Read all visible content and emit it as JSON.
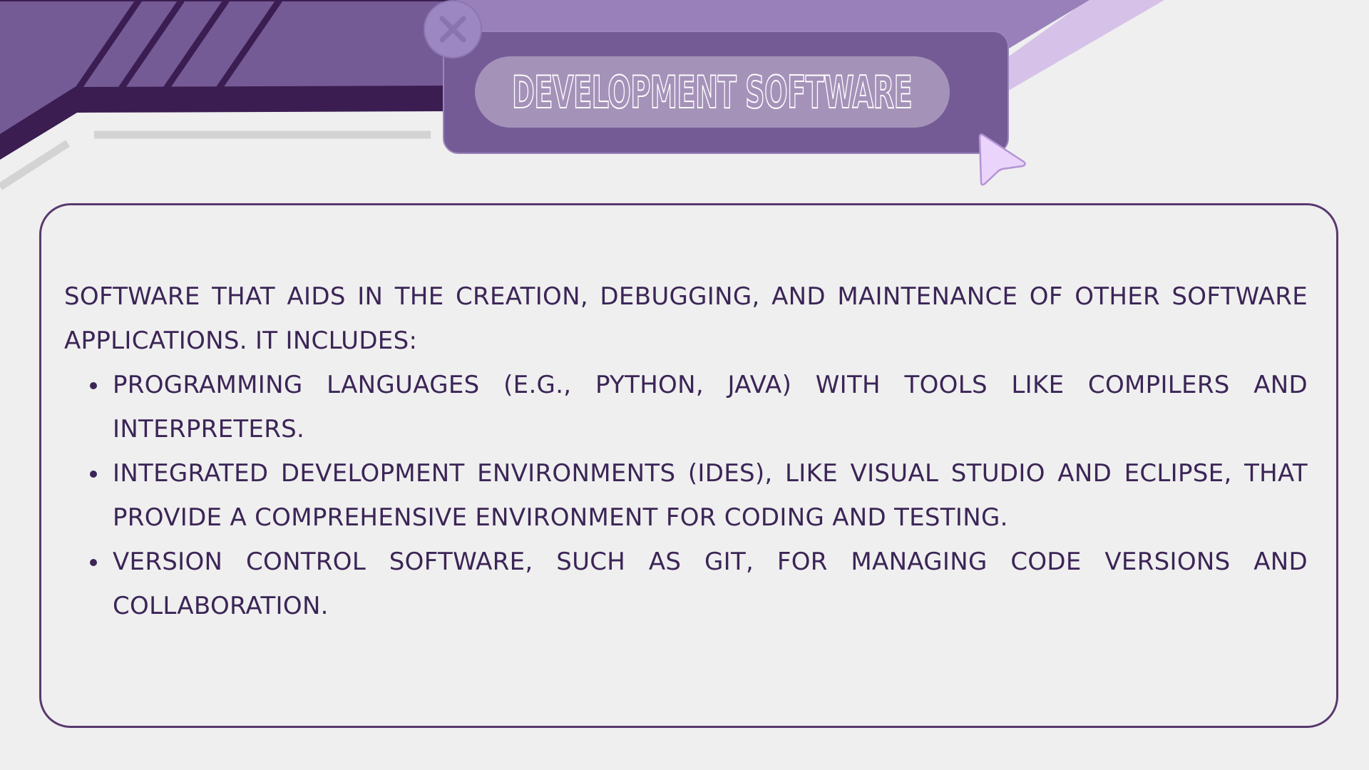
{
  "slide": {
    "title": "DEVELOPMENT SOFTWARE",
    "intro": "SOFTWARE THAT AIDS IN THE CREATION, DEBUGGING, AND MAINTENANCE OF OTHER SOFTWARE APPLICATIONS. IT INCLUDES:",
    "bullets": [
      "PROGRAMMING LANGUAGES (E.G., PYTHON, JAVA) WITH TOOLS LIKE COMPILERS AND INTERPRETERS.",
      "INTEGRATED DEVELOPMENT ENVIRONMENTS (IDES), LIKE VISUAL STUDIO AND ECLIPSE, THAT PROVIDE A COMPREHENSIVE ENVIRONMENT FOR CODING AND TESTING.",
      "VERSION CONTROL SOFTWARE, SUCH AS GIT, FOR MANAGING CODE VERSIONS AND COLLABORATION."
    ]
  },
  "icons": {
    "close": "close-icon",
    "pointer": "cursor-arrow-icon"
  },
  "colors": {
    "background": "#efefef",
    "deep_purple": "#3b1d52",
    "mid_purple": "#755b96",
    "light_purple": "#9a80bb",
    "lavender": "#d9c2e8",
    "text": "#3b2556"
  }
}
